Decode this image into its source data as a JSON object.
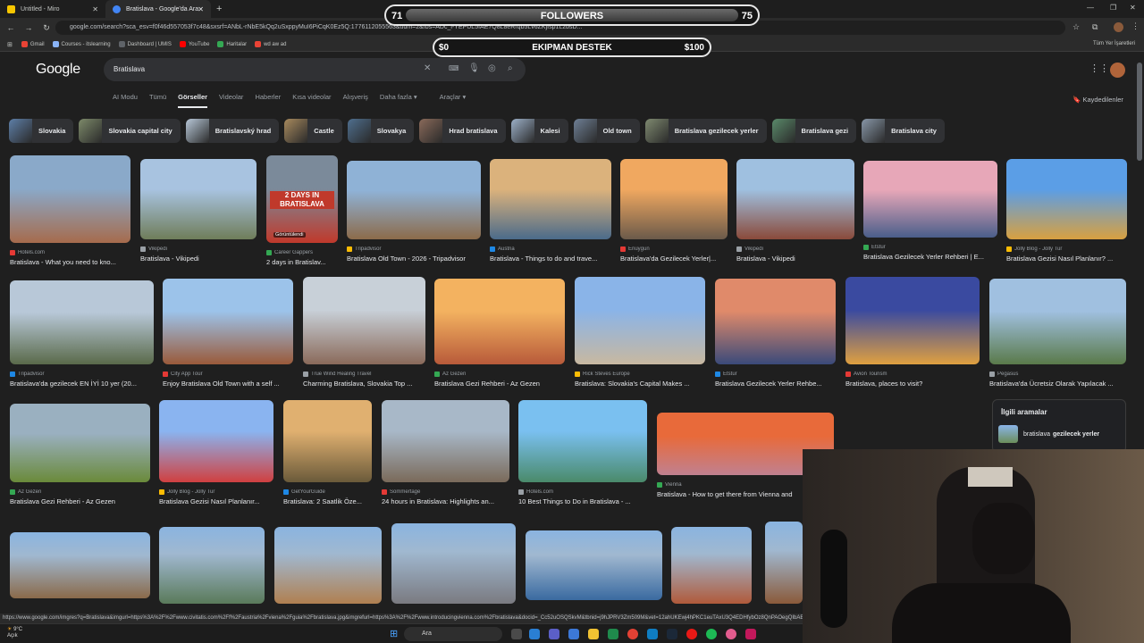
{
  "browser": {
    "tabs": [
      {
        "title": "Untitled - Miro",
        "color": "#f7c600"
      },
      {
        "title": "Bratislava - Google'da Ara",
        "color": "#4285f4"
      }
    ],
    "url": "google.com/search?sca_esv=f0f46d557053f7c48&sxsrf=ANbL-rNbE5kQq2uSxppyMuI6PiCqK0Ez5Q:1776112055563&udm=2&fbs=ADc_l-YEPUL5fAE7Q8L8eRrqb5Lv6ZKjIsp1L2bsD...",
    "bookmarks": [
      {
        "label": "Gmail",
        "color": "#ea4335"
      },
      {
        "label": "Courses - itslearning",
        "color": "#8ab4f8"
      },
      {
        "label": "Dashboard | UMIS",
        "color": "#5f6368"
      },
      {
        "label": "YouTube",
        "color": "#ff0000"
      },
      {
        "label": "Haritalar",
        "color": "#34a853"
      },
      {
        "label": "wd aw ad",
        "color": "#ea4335"
      }
    ],
    "bookmarks_right": "Tüm Yer İşaretleri"
  },
  "overlay": {
    "followers": {
      "left": "71",
      "label": "FOLLOWERS",
      "right": "75"
    },
    "ekipman": {
      "left": "$0",
      "label": "EKIPMAN DESTEK",
      "right": "$100"
    }
  },
  "google": {
    "logo": "Google",
    "query": "Bratislava",
    "tabs": [
      "AI Modu",
      "Tümü",
      "Görseller",
      "Videolar",
      "Haberler",
      "Kısa videolar",
      "Alışveriş",
      "Daha fazla ▾",
      "Araçlar ▾"
    ],
    "saved": "Kaydedilenler",
    "chips": [
      "Slovakia",
      "Slovakia capital city",
      "Bratislavský hrad",
      "Castle",
      "Slovakya",
      "Hrad bratislava",
      "Kalesi",
      "Old town",
      "Bratislava gezilecek yerler",
      "Bratislava gezi",
      "Bratislava city"
    ],
    "results": [
      {
        "src": "Hotels.com",
        "title": "Bratislava - What you need to kno..."
      },
      {
        "src": "Vikipedi",
        "title": "Bratislava - Vikipedi"
      },
      {
        "src": "Career Gappers",
        "title": "2 days in Bratislav..."
      },
      {
        "src": "Tripadvisor",
        "title": "Bratislava Old Town - 2026 - Tripadvisor"
      },
      {
        "src": "Austria",
        "title": "Bratislava - Things to do and trave..."
      },
      {
        "src": "Enuygun",
        "title": "Bratislava'da Gezilecek Yerler|..."
      },
      {
        "src": "Vikipedi",
        "title": "Bratislava - Vikipedi"
      },
      {
        "src": "Etstur",
        "title": "Bratislava Gezilecek Yerler Rehberi | E..."
      },
      {
        "src": "Jolly Blog - Jolly Tur",
        "title": "Bratislava Gezisi Nasıl Planlanır? ..."
      },
      {
        "src": "Tripadvisor",
        "title": "Bratislava'da gezilecek EN İYİ 10 yer (20..."
      },
      {
        "src": "City App Tour",
        "title": "Enjoy Bratislava Old Town with a self ..."
      },
      {
        "src": "True Wind Healing Travel",
        "title": "Charming Bratislava, Slovakia Top ..."
      },
      {
        "src": "Az Gezen",
        "title": "Bratislava Gezi Rehberi - Az Gezen"
      },
      {
        "src": "Rick Steves Europe",
        "title": "Bratislava: Slovakia's Capital Makes ..."
      },
      {
        "src": "Etstur",
        "title": "Bratislava Gezilecek Yerler Rehbe..."
      },
      {
        "src": "Avion Tourism",
        "title": "Bratislava, places to visit?"
      },
      {
        "src": "Pegasus",
        "title": "Bratislava'da Ücretsiz Olarak Yapılacak ..."
      },
      {
        "src": "Az Gezen",
        "title": "Bratislava Gezi Rehberi - Az Gezen"
      },
      {
        "src": "Jolly Blog - Jolly Tur",
        "title": "Bratislava Gezisi Nasıl Planlanır..."
      },
      {
        "src": "GetYourGuide",
        "title": "Bratislava: 2 Saatlik Öze..."
      },
      {
        "src": "Sommertage",
        "title": "24 hours in Bratislava: Highlights an..."
      },
      {
        "src": "Hotels.com",
        "title": "10 Best Things to Do in Bratislava - ..."
      },
      {
        "src": "Vienna",
        "title": "Bratislava - How to get there from Vienna and"
      }
    ],
    "video_badge": "Görüntülendi",
    "thumb_caption": "2 DAYS IN BRATISLAVA",
    "related": {
      "heading": "İlgili aramalar",
      "item_prefix": "bratislava",
      "item_bold": "gezilecek yerler"
    }
  },
  "status_url": "https://www.google.com/imgres?q=Bratislava&imgurl=https%3A%2F%2Fwww.civitatis.com%2Ff%2Faustria%2Fviena%2Fguia%2Fbratislava.jpg&imgrefurl=https%3A%2F%2Fwww.introducingvienna.com%2Fbratislava&docid=_Cc52uOSQSkvM&tbnid=j9hJPRV3Zm509M&vet=12ahUKEwj4hPKC1euTAxU3Q4EDHfybOz8QnPAOegQIbAB..i&w",
  "taskbar": {
    "weather_temp": "9°C",
    "weather_desc": "Açık",
    "search": "Ara"
  }
}
